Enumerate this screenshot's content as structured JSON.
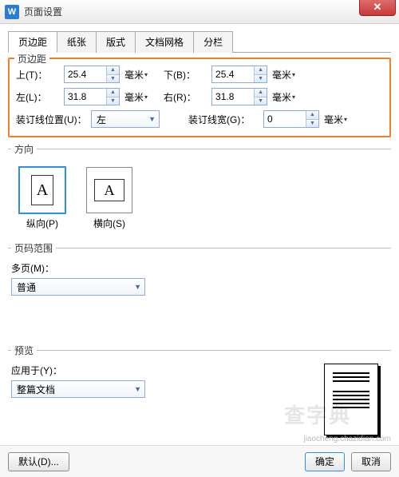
{
  "window": {
    "app_icon_letter": "W",
    "title": "页面设置",
    "close_glyph": "✕"
  },
  "tabs": {
    "margin": "页边距",
    "paper": "纸张",
    "layout": "版式",
    "grid": "文档网格",
    "columns": "分栏"
  },
  "margins": {
    "legend": "页边距",
    "top_label": "上(T)：",
    "top_value": "25.4",
    "bottom_label": "下(B)：",
    "bottom_value": "25.4",
    "left_label": "左(L)：",
    "left_value": "31.8",
    "right_label": "右(R)：",
    "right_value": "31.8",
    "gutter_pos_label": "装订线位置(U)：",
    "gutter_pos_value": "左",
    "gutter_width_label": "装订线宽(G)：",
    "gutter_width_value": "0",
    "unit": "毫米",
    "unit_caret": "▾"
  },
  "orientation": {
    "legend": "方向",
    "icon_letter": "A",
    "portrait": "纵向(P)",
    "landscape": "横向(S)"
  },
  "pagerange": {
    "legend": "页码范围",
    "multi_label": "多页(M)：",
    "multi_value": "普通"
  },
  "preview": {
    "legend": "预览",
    "apply_label": "应用于(Y)：",
    "apply_value": "整篇文档"
  },
  "buttons": {
    "default": "默认(D)...",
    "ok": "确定",
    "cancel": "取消"
  },
  "branding": {
    "watermark": "查字典",
    "credit": "jiaocheng.chazidian.com"
  }
}
